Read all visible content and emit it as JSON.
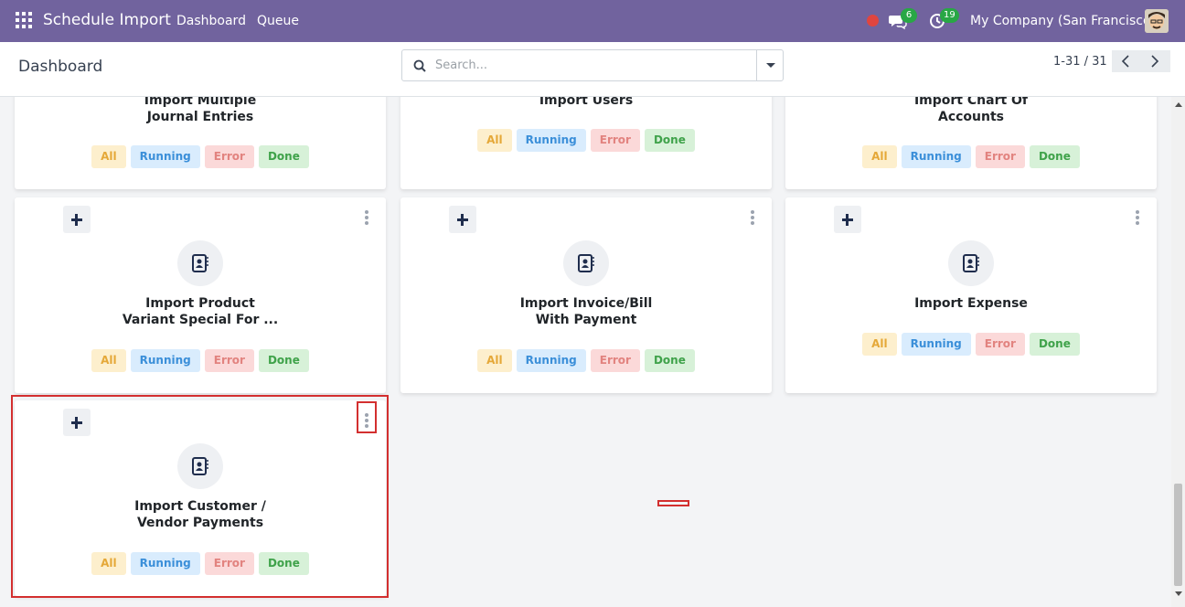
{
  "navbar": {
    "app_title": "Schedule Import",
    "links": [
      "Dashboard",
      "Queue"
    ],
    "messages_badge": "6",
    "activities_badge": "19",
    "company": "My Company (San Francisco)"
  },
  "control_panel": {
    "breadcrumb": "Dashboard",
    "search_placeholder": "Search...",
    "pager": "1-31 / 31"
  },
  "cards": [
    {
      "title_lines": [
        "Import Multiple",
        "Journal Entries"
      ]
    },
    {
      "title_lines": [
        "Import Users",
        ""
      ]
    },
    {
      "title_lines": [
        "Import Chart Of",
        "Accounts"
      ]
    },
    {
      "title_lines": [
        "Import Product",
        "Variant Special For ..."
      ]
    },
    {
      "title_lines": [
        "Import Invoice/Bill",
        "With Payment"
      ]
    },
    {
      "title_lines": [
        "Import Expense",
        ""
      ]
    },
    {
      "title_lines": [
        "Import Customer /",
        "Vendor Payments"
      ]
    }
  ],
  "chips": {
    "all": "All",
    "running": "Running",
    "error": "Error",
    "done": "Done"
  },
  "colors": {
    "navbar": "#71639e",
    "highlight": "#d32f2f",
    "badge": "#28a745"
  }
}
